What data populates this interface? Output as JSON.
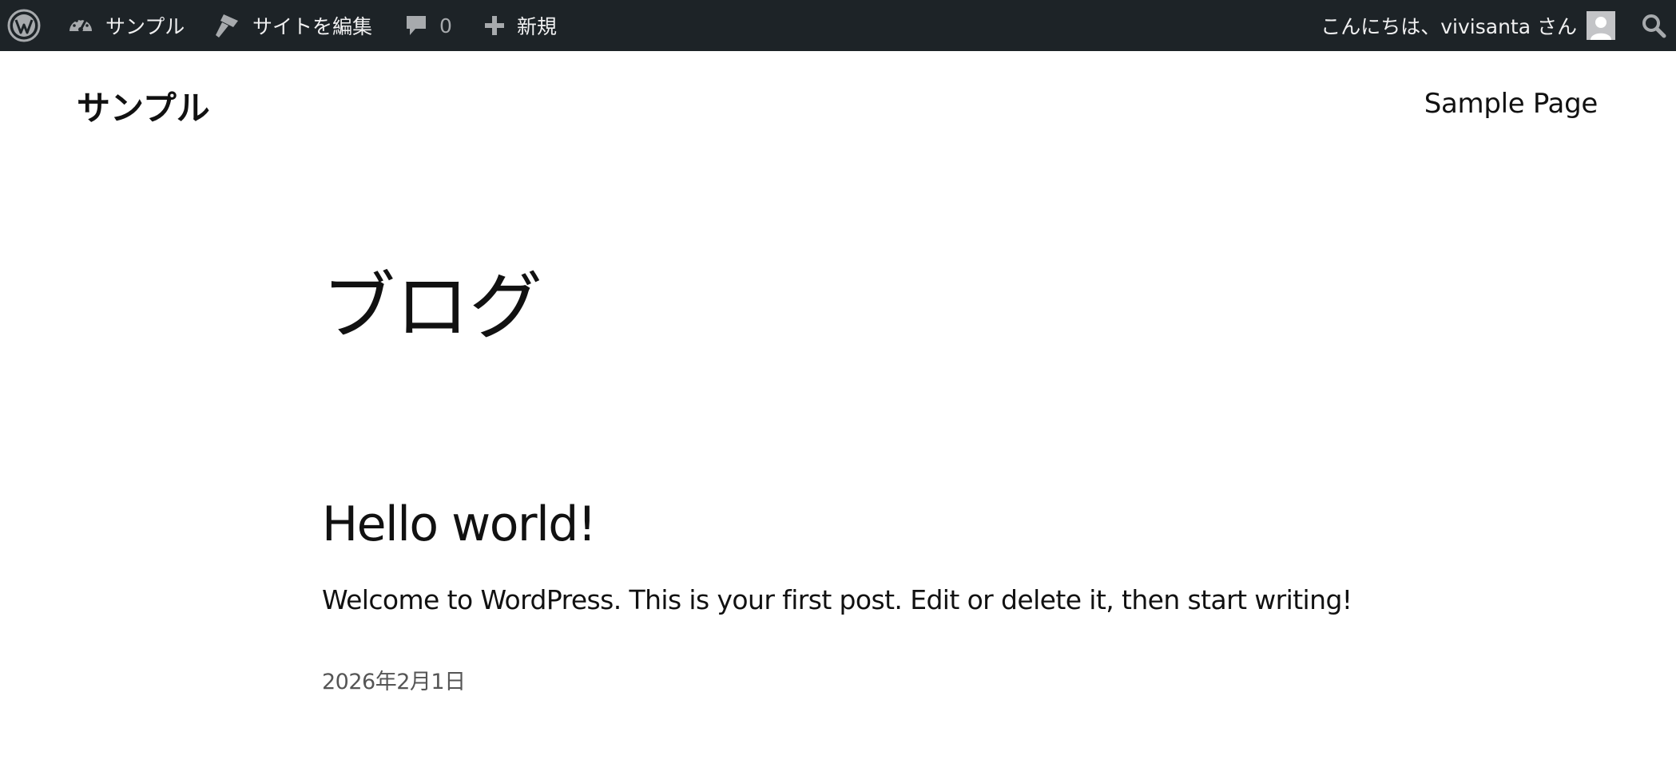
{
  "admin_bar": {
    "site_name": "サンプル",
    "edit_site": "サイトを編集",
    "comments_count": "0",
    "new_label": "新規",
    "greeting": "こんにちは、vivisanta さん",
    "icons": [
      "wordpress-logo-icon",
      "dashboard-icon",
      "brush-icon",
      "comment-icon",
      "plus-icon",
      "avatar",
      "search-icon"
    ]
  },
  "site": {
    "title": "サンプル",
    "nav": [
      "Sample Page"
    ]
  },
  "main": {
    "heading": "ブログ",
    "posts": [
      {
        "title": "Hello world!",
        "excerpt": "Welcome to WordPress. This is your first post. Edit or delete it, then start writing!",
        "date": "2026年2月1日"
      }
    ]
  },
  "colors": {
    "admin_bar_bg": "#1d2327",
    "admin_bar_text": "#f0f0f1",
    "text": "#111111",
    "muted": "#555555"
  }
}
